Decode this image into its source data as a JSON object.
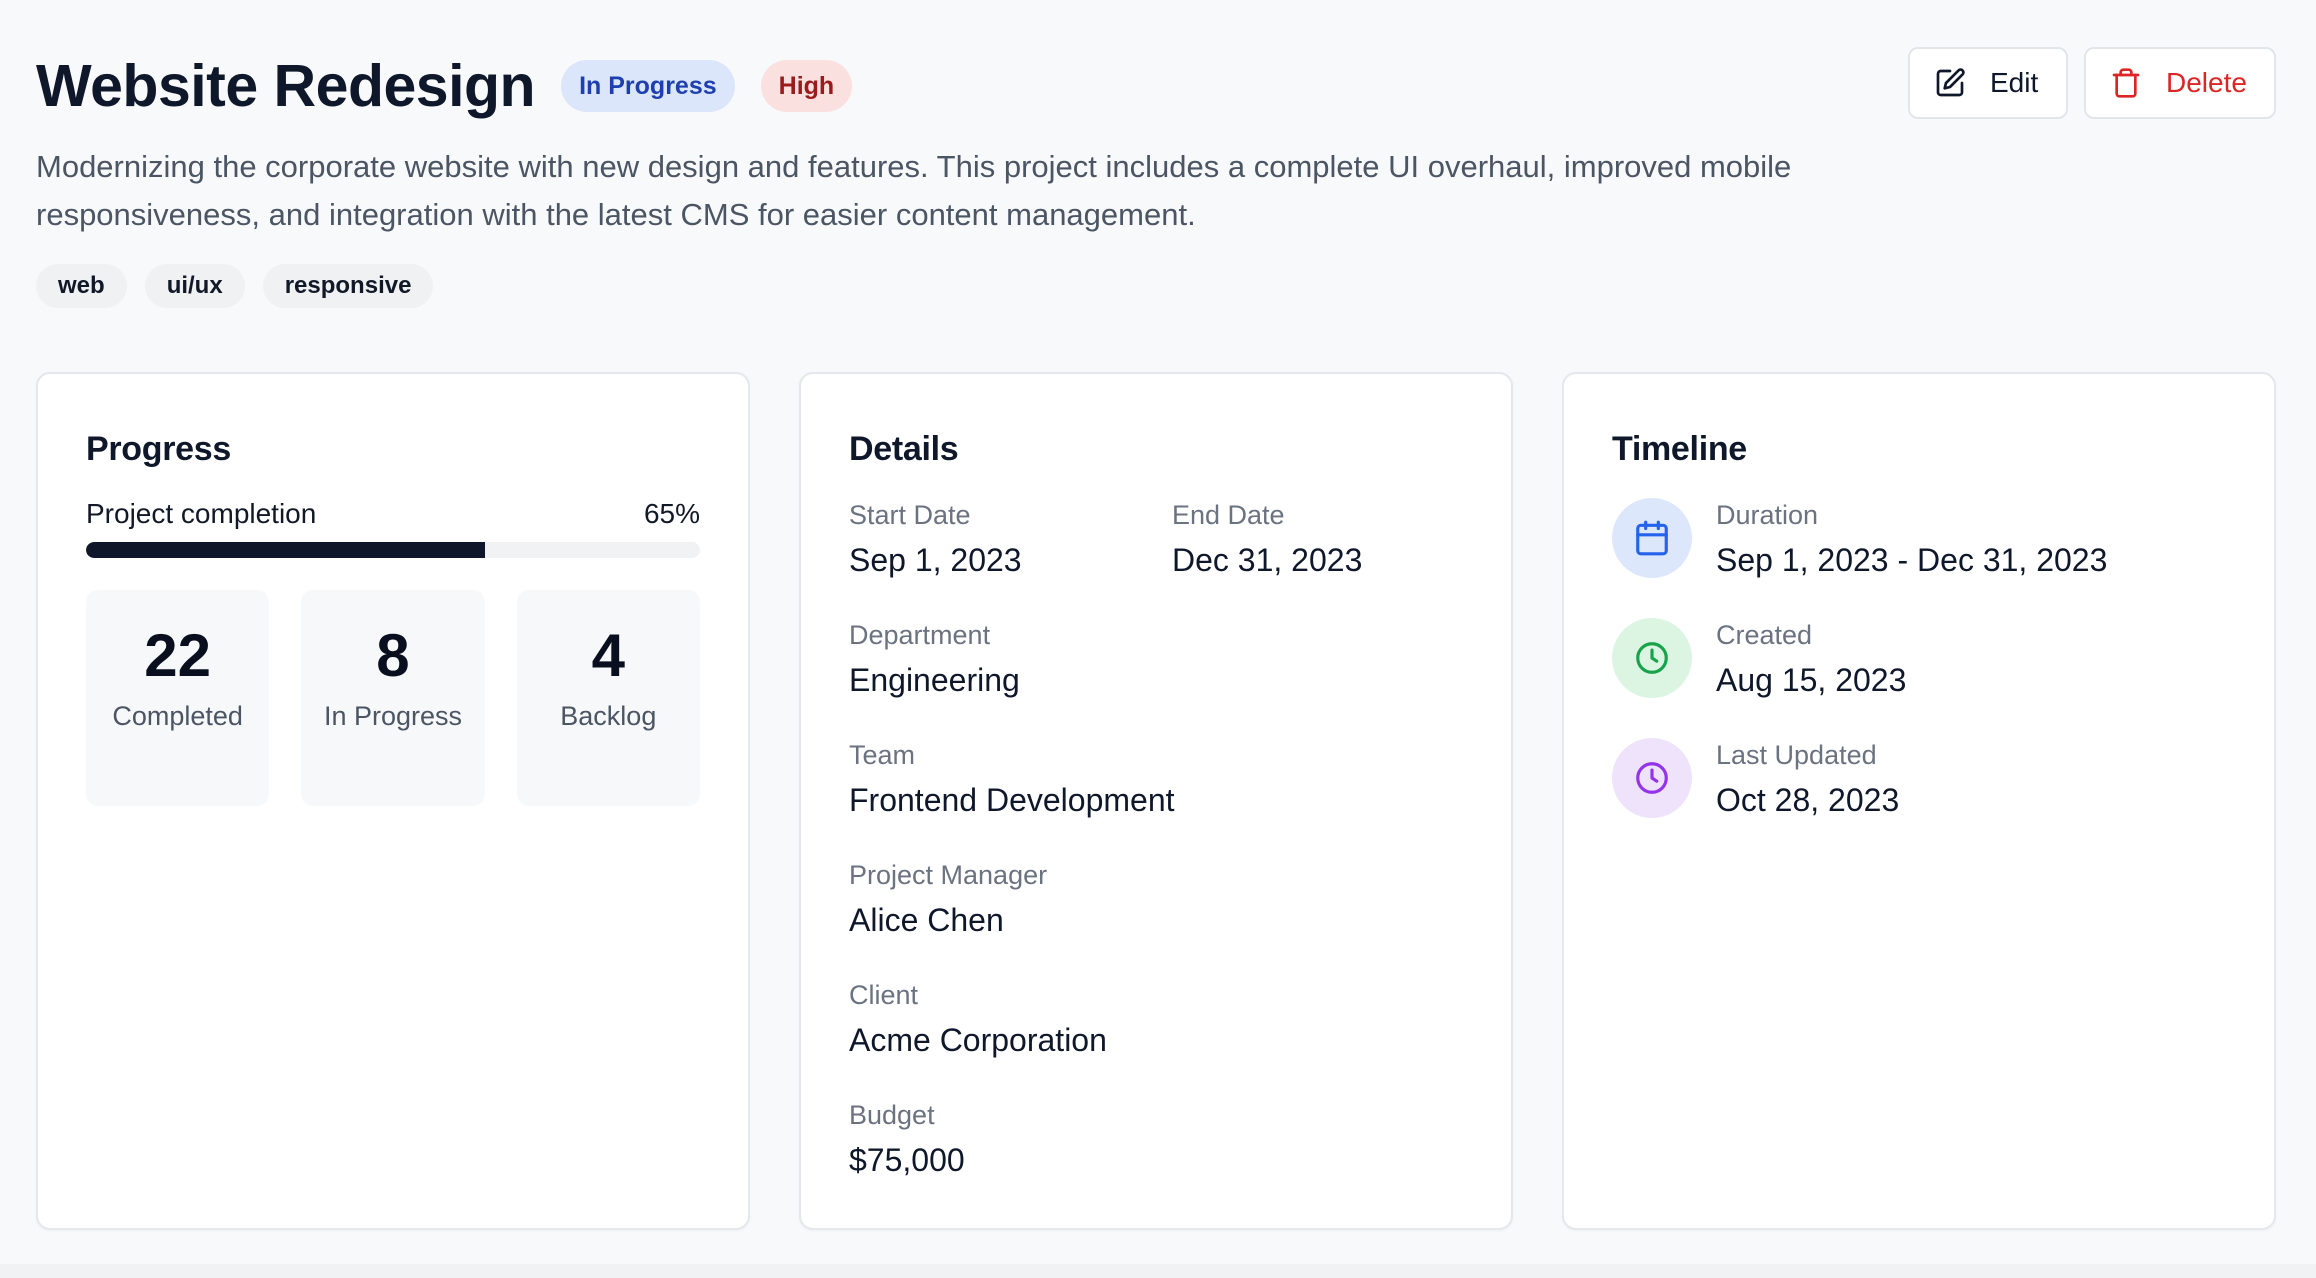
{
  "header": {
    "title": "Website Redesign",
    "status_badge": "In Progress",
    "priority_badge": "High",
    "edit_label": "Edit",
    "delete_label": "Delete",
    "description": "Modernizing the corporate website with new design and features. This project includes a complete UI overhaul, improved mobile responsiveness, and integration with the latest CMS for easier content management.",
    "tags": [
      "web",
      "ui/ux",
      "responsive"
    ]
  },
  "progress": {
    "title": "Progress",
    "completion_label": "Project completion",
    "completion_percent": 65,
    "completion_text": "65%",
    "stats": [
      {
        "value": "22",
        "label": "Completed"
      },
      {
        "value": "8",
        "label": "In Progress"
      },
      {
        "value": "4",
        "label": "Backlog"
      }
    ]
  },
  "details": {
    "title": "Details",
    "start_date": {
      "label": "Start Date",
      "value": "Sep 1, 2023"
    },
    "end_date": {
      "label": "End Date",
      "value": "Dec 31, 2023"
    },
    "department": {
      "label": "Department",
      "value": "Engineering"
    },
    "team": {
      "label": "Team",
      "value": "Frontend Development"
    },
    "project_manager": {
      "label": "Project Manager",
      "value": "Alice Chen"
    },
    "client": {
      "label": "Client",
      "value": "Acme Corporation"
    },
    "budget": {
      "label": "Budget",
      "value": "$75,000"
    }
  },
  "timeline": {
    "title": "Timeline",
    "duration": {
      "label": "Duration",
      "value": "Sep 1, 2023 - Dec 31, 2023",
      "icon": "calendar-icon"
    },
    "created": {
      "label": "Created",
      "value": "Aug 15, 2023",
      "icon": "clock-icon"
    },
    "last_updated": {
      "label": "Last Updated",
      "value": "Oct 28, 2023",
      "icon": "clock-icon"
    }
  },
  "colors": {
    "primary": "#0f172a",
    "danger": "#dc2626",
    "status_bg": "#dbe6fb",
    "priority_bg": "#fbe0e0"
  }
}
